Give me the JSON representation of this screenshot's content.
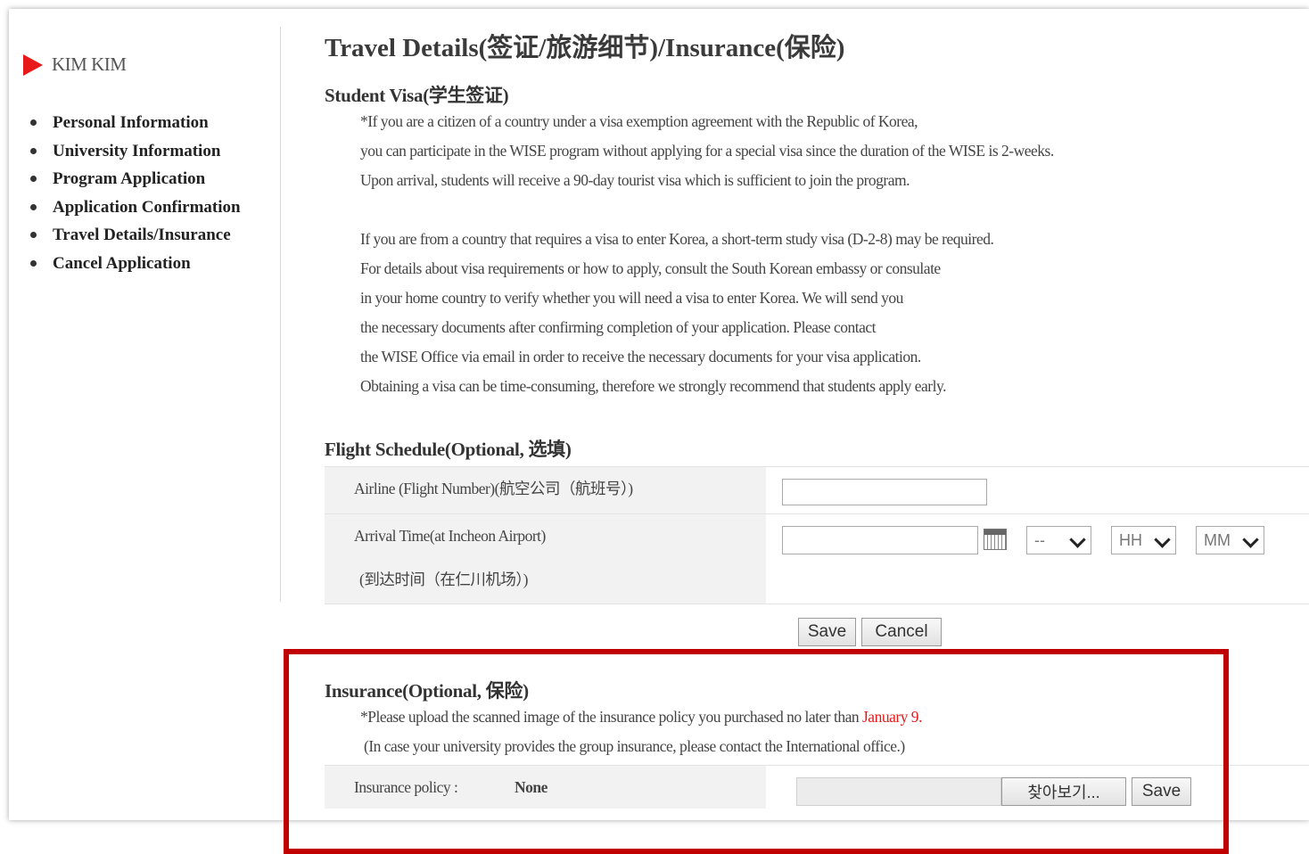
{
  "sidebar": {
    "user_name": "KIM KIM",
    "items": [
      {
        "label": "Personal Information"
      },
      {
        "label": "University Information"
      },
      {
        "label": "Program Application"
      },
      {
        "label": "Application Confirmation"
      },
      {
        "label": "Travel Details/Insurance"
      },
      {
        "label": "Cancel Application"
      }
    ]
  },
  "page": {
    "title": "Travel Details(签证/旅游细节)/Insurance(保险)"
  },
  "visa": {
    "title": "Student Visa(学生签证)",
    "lines": [
      "*If you are a citizen of a country under a visa exemption agreement with the Republic of Korea,",
      "you can participate in the WISE program without applying for a special visa since the duration of the WISE is 2-weeks.",
      "Upon arrival, students will receive a 90-day tourist visa which is sufficient to join the program.",
      "",
      "If you are from a country that requires a visa to enter Korea, a short-term study visa (D-2-8) may be required.",
      "For details about visa requirements or how to apply, consult the South Korean embassy or consulate",
      "in your home country to verify whether you will need a visa to enter Korea. We will send you",
      "the necessary documents after confirming completion of your application. Please contact",
      "the WISE Office via email in order to receive the necessary documents for your visa application.",
      "Obtaining a visa can be time-consuming, therefore we strongly recommend that students apply early."
    ]
  },
  "flight": {
    "title": "Flight Schedule(Optional, 选填)",
    "airline_label": "Airline (Flight Number)(航空公司（航班号）)",
    "airline_value": "",
    "arrival_label_1": "Arrival Time(at Incheon Airport)",
    "arrival_label_2": "(到达时间（在仁川机场）)",
    "arrival_date_value": "",
    "ampm_selected": "--",
    "hour_selected": "HH",
    "minute_selected": "MM",
    "save_label": "Save",
    "cancel_label": "Cancel"
  },
  "insurance": {
    "title": "Insurance(Optional, 保险)",
    "note_prefix": "*Please upload the scanned image of the insurance policy you purchased no later than ",
    "note_deadline": "January 9",
    "note_suffix": ".",
    "note_2": "(In case your university provides the group insurance, please contact the International office.)",
    "policy_label": "Insurance policy :",
    "policy_value": "None",
    "browse_label": "찾아보기...",
    "save_label": "Save"
  },
  "colors": {
    "accent_red": "#e8191a",
    "highlight_border": "#c00000"
  }
}
